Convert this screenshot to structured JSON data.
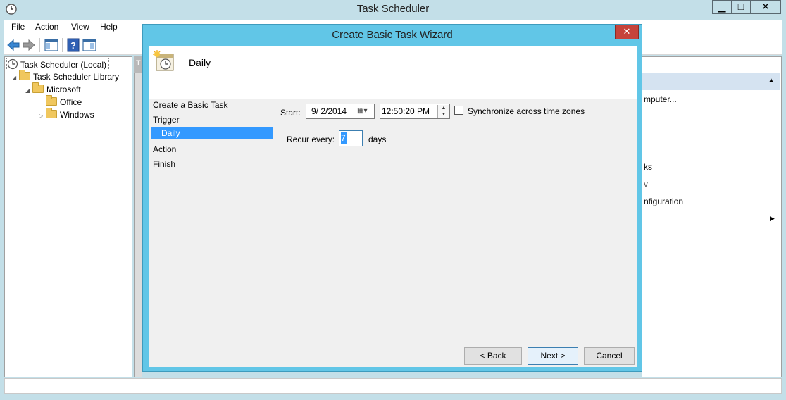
{
  "main_window": {
    "title": "Task Scheduler",
    "controls": {
      "minimize": "▁",
      "maximize": "□",
      "close": "✕"
    },
    "menu": [
      "File",
      "Action",
      "View",
      "Help"
    ]
  },
  "tree": {
    "items": [
      {
        "label": "Task Scheduler (Local)",
        "level": 0,
        "expander": ""
      },
      {
        "label": "Task Scheduler Library",
        "level": 1,
        "expander": "◢"
      },
      {
        "label": "Microsoft",
        "level": 2,
        "expander": "◢"
      },
      {
        "label": "Office",
        "level": 3,
        "expander": ""
      },
      {
        "label": "Windows",
        "level": 3,
        "expander": "▷"
      }
    ]
  },
  "middle_pane": {
    "header_fragment": "T"
  },
  "actions_pane": {
    "items": [
      {
        "text": "mputer..."
      },
      {
        "text": "ks"
      },
      {
        "text": "v"
      },
      {
        "text": "nfiguration"
      }
    ],
    "collapse_glyph": "▲",
    "submenu_glyph": "▶"
  },
  "wizard": {
    "title": "Create Basic Task Wizard",
    "close_glyph": "✕",
    "heading": "Daily",
    "steps": [
      "Create a Basic Task",
      "Trigger",
      "Daily",
      "Action",
      "Finish"
    ],
    "form": {
      "start_label": "Start:",
      "start_date": "9/  2/2014",
      "start_time": "12:50:20 PM",
      "sync_label": "Synchronize across time zones",
      "sync_checked": false,
      "recur_label": "Recur every:",
      "recur_value": "7",
      "recur_unit": "days"
    },
    "buttons": {
      "back": "< Back",
      "next": "Next >",
      "cancel": "Cancel"
    }
  },
  "colors": {
    "dialog_frame": "#61c6e7",
    "selection": "#3399ff",
    "close_button": "#c6433a",
    "window_frame": "#c3dfe8"
  }
}
